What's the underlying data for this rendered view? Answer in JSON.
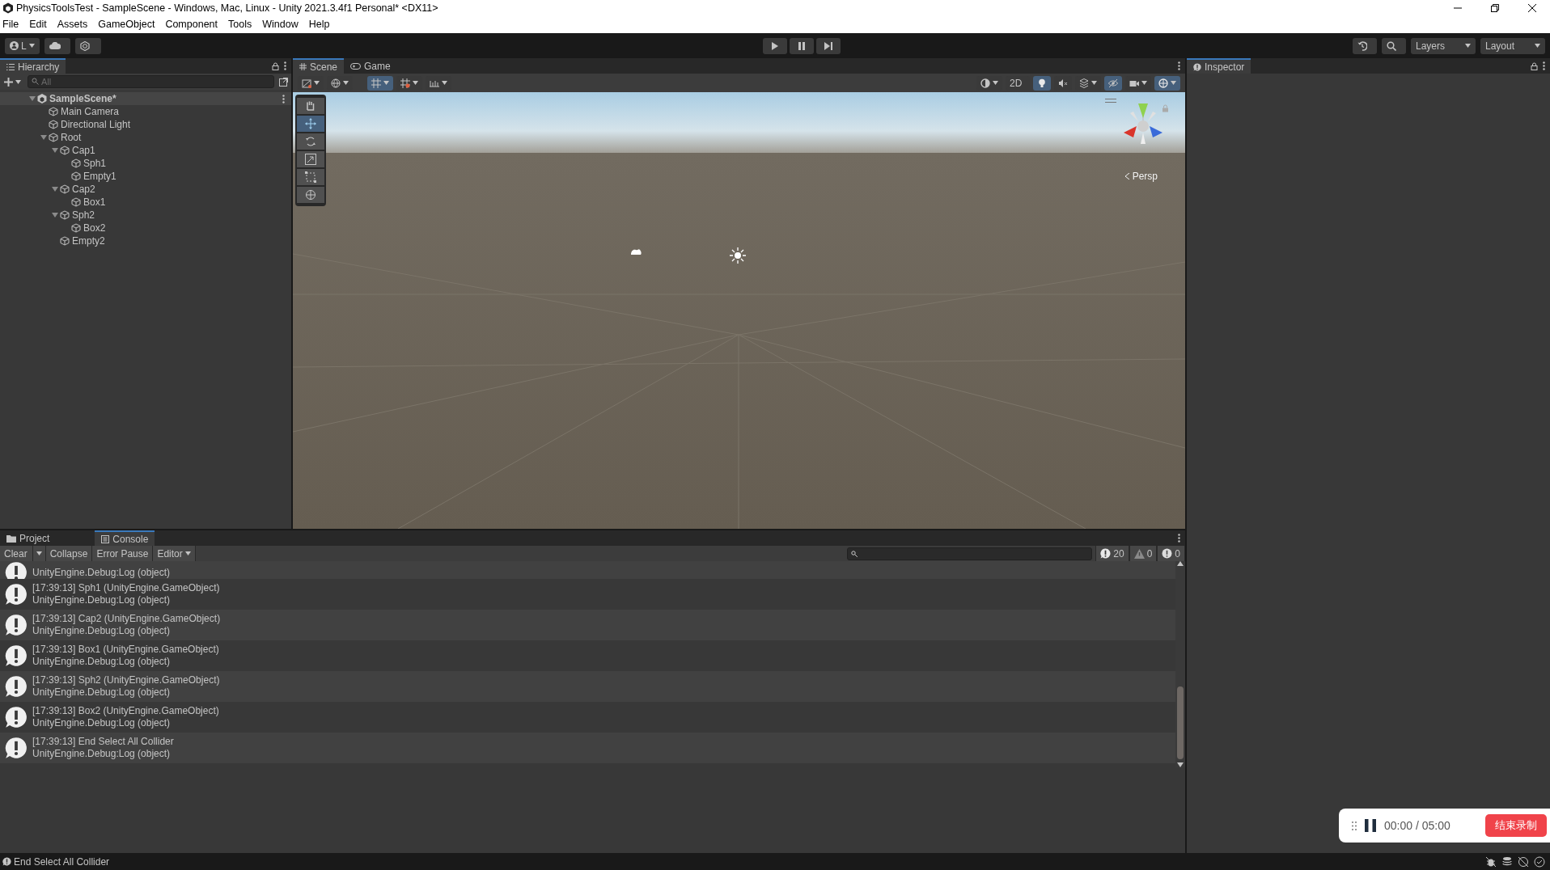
{
  "window": {
    "title": "PhysicsToolsTest - SampleScene - Windows, Mac, Linux - Unity 2021.3.4f1 Personal* <DX11>"
  },
  "menu": [
    "File",
    "Edit",
    "Assets",
    "GameObject",
    "Component",
    "Tools",
    "Window",
    "Help"
  ],
  "main_toolbar": {
    "account": "L",
    "play": {
      "on": false
    },
    "pause": {
      "on": false
    },
    "layers": "Layers",
    "layout": "Layout"
  },
  "hierarchy": {
    "tab": "Hierarchy",
    "search_placeholder": "All",
    "items": [
      {
        "label": "SampleScene*",
        "kind": "scene",
        "expanded": true,
        "children": [
          {
            "label": "Main Camera"
          },
          {
            "label": "Directional Light"
          },
          {
            "label": "Root",
            "expanded": true,
            "children": [
              {
                "label": "Cap1",
                "expanded": true,
                "children": [
                  {
                    "label": "Sph1"
                  },
                  {
                    "label": "Empty1"
                  }
                ]
              },
              {
                "label": "Cap2",
                "expanded": true,
                "children": [
                  {
                    "label": "Box1"
                  }
                ]
              },
              {
                "label": "Sph2",
                "expanded": true,
                "children": [
                  {
                    "label": "Box2"
                  }
                ]
              },
              {
                "label": "Empty2"
              }
            ]
          }
        ]
      }
    ]
  },
  "scene_tabs": [
    {
      "label": "Scene",
      "selected": true
    },
    {
      "label": "Game",
      "selected": false
    }
  ],
  "scene_toolbar_left": [
    {
      "kind": "dropdown",
      "on": false
    },
    {
      "kind": "dropdown",
      "on": false
    },
    {
      "kind": "dropdown",
      "on": true
    },
    {
      "kind": "dropdown",
      "on": false
    },
    {
      "kind": "dropdown",
      "on": false
    }
  ],
  "scene_toolbar_right": [
    {
      "kind": "dropdown",
      "on": false
    },
    {
      "kind": "toggle",
      "label": "2D",
      "on": false
    },
    {
      "kind": "toggle",
      "on": true
    },
    {
      "kind": "toggle",
      "on": false
    },
    {
      "kind": "dropdown",
      "on": false
    },
    {
      "kind": "toggle",
      "on": true
    },
    {
      "kind": "dropdown",
      "on": false
    },
    {
      "kind": "dropdown",
      "on": true
    }
  ],
  "scene_tools": [
    {
      "selected": false
    },
    {
      "selected": true
    },
    {
      "selected": false
    },
    {
      "selected": false
    },
    {
      "selected": false
    },
    {
      "selected": false
    }
  ],
  "scene_view": {
    "projection": "Persp"
  },
  "inspector": {
    "tab": "Inspector"
  },
  "bottom_tabs": [
    {
      "label": "Project",
      "selected": false
    },
    {
      "label": "Console",
      "selected": true
    }
  ],
  "console_toolbar": {
    "buttons": [
      {
        "label": "Clear",
        "kind": "split"
      },
      {
        "label": "Collapse",
        "kind": "toggle"
      },
      {
        "label": "Error Pause",
        "kind": "toggle"
      },
      {
        "label": "Editor",
        "kind": "dropdown"
      }
    ],
    "counts": [
      {
        "kind": "info",
        "count": "20"
      },
      {
        "kind": "warning",
        "count": "0"
      },
      {
        "kind": "error",
        "count": "0"
      }
    ]
  },
  "console_entries": [
    {
      "detail": "UnityEngine.Debug:Log (object)"
    },
    {
      "message": "[17:39:13] Sph1 (UnityEngine.GameObject)",
      "detail": "UnityEngine.Debug:Log (object)"
    },
    {
      "message": "[17:39:13] Cap2 (UnityEngine.GameObject)",
      "detail": "UnityEngine.Debug:Log (object)"
    },
    {
      "message": "[17:39:13] Box1 (UnityEngine.GameObject)",
      "detail": "UnityEngine.Debug:Log (object)"
    },
    {
      "message": "[17:39:13] Sph2 (UnityEngine.GameObject)",
      "detail": "UnityEngine.Debug:Log (object)"
    },
    {
      "message": "[17:39:13] Box2 (UnityEngine.GameObject)",
      "detail": "UnityEngine.Debug:Log (object)"
    },
    {
      "message": "[17:39:13] End Select All Collider",
      "detail": "UnityEngine.Debug:Log (object)"
    }
  ],
  "status_bar": {
    "message": "End Select All Collider"
  },
  "recorder": {
    "time": "00:00 / 05:00",
    "stop_button": "结束录制"
  }
}
